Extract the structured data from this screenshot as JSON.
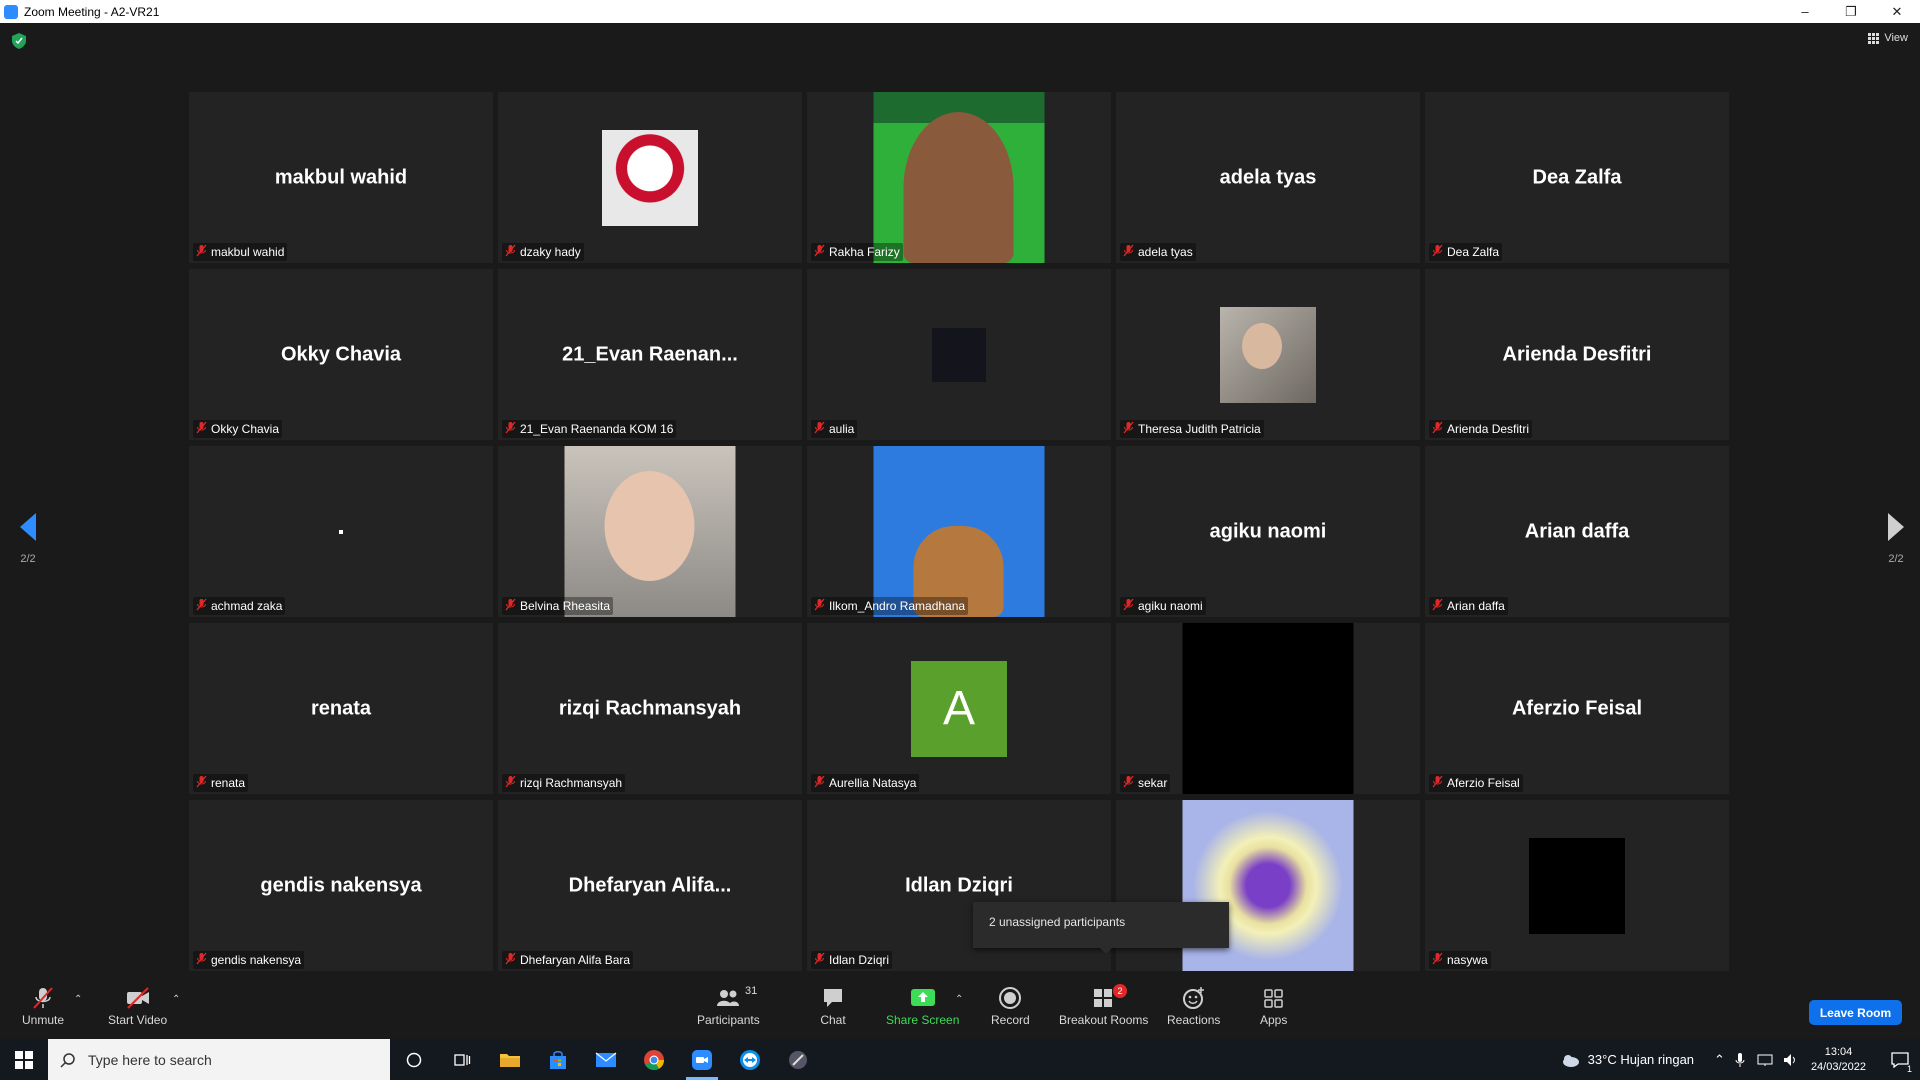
{
  "window": {
    "title": "Zoom Meeting - A2-VR21"
  },
  "header": {
    "view_label": "View"
  },
  "pagination": {
    "left": "2/2",
    "right": "2/2"
  },
  "tiles": [
    {
      "display": "makbul wahid",
      "label": "makbul wahid",
      "kind": "text"
    },
    {
      "display": "",
      "label": "dzaky hady",
      "kind": "picture-persija"
    },
    {
      "display": "",
      "label": "Rakha Farizy",
      "kind": "video-green"
    },
    {
      "display": "adela tyas",
      "label": "adela tyas",
      "kind": "text"
    },
    {
      "display": "Dea Zalfa",
      "label": "Dea Zalfa",
      "kind": "text"
    },
    {
      "display": "Okky Chavia",
      "label": "Okky Chavia",
      "kind": "text"
    },
    {
      "display": "21_Evan  Raenan...",
      "label": "21_Evan Raenanda KOM 16",
      "kind": "text"
    },
    {
      "display": "",
      "label": "aulia",
      "kind": "dark-square"
    },
    {
      "display": "",
      "label": "Theresa Judith Patricia",
      "kind": "picture-theresa"
    },
    {
      "display": "Arienda Desfitri",
      "label": "Arienda Desfitri",
      "kind": "text"
    },
    {
      "display": ".",
      "label": "achmad zaka",
      "kind": "dot"
    },
    {
      "display": "",
      "label": "Belvina Rheasita",
      "kind": "video-belvina"
    },
    {
      "display": "",
      "label": "Ilkom_Andro Ramadhana",
      "kind": "video-dog"
    },
    {
      "display": "agiku naomi",
      "label": "agiku naomi",
      "kind": "text"
    },
    {
      "display": "Arian daffa",
      "label": "Arian daffa",
      "kind": "text"
    },
    {
      "display": "renata",
      "label": "renata",
      "kind": "text"
    },
    {
      "display": "rizqi Rachmansyah",
      "label": "rizqi Rachmansyah",
      "kind": "text"
    },
    {
      "display": "A",
      "label": "Aurellia Natasya",
      "kind": "letter"
    },
    {
      "display": "",
      "label": "sekar",
      "kind": "video-black"
    },
    {
      "display": "Aferzio Feisal",
      "label": "Aferzio Feisal",
      "kind": "text"
    },
    {
      "display": "gendis nakensya",
      "label": "gendis nakensya",
      "kind": "text"
    },
    {
      "display": "Dhefaryan  Alifa...",
      "label": "Dhefaryan Alifa Bara",
      "kind": "text"
    },
    {
      "display": "Idlan Dziqri",
      "label": "Idlan Dziqri",
      "kind": "text"
    },
    {
      "display": "",
      "label": "",
      "kind": "video-heart"
    },
    {
      "display": "",
      "label": "nasywa",
      "kind": "black-square"
    }
  ],
  "popup": {
    "text": "2 unassigned participants"
  },
  "toolbar": {
    "unmute": "Unmute",
    "start_video": "Start Video",
    "participants": "Participants",
    "participants_count": "31",
    "chat": "Chat",
    "share_screen": "Share Screen",
    "record": "Record",
    "breakout_rooms": "Breakout Rooms",
    "breakout_badge": "2",
    "reactions": "Reactions",
    "apps": "Apps",
    "leave": "Leave Room"
  },
  "taskbar": {
    "search_placeholder": "Type here to search",
    "weather": "33°C  Hujan ringan",
    "time": "13:04",
    "date": "24/03/2022",
    "notifications": "1"
  },
  "colors": {
    "accent": "#2d8cff",
    "share_green": "#3ddc56",
    "leave_blue": "#0e71eb",
    "muted_red": "#e02828",
    "letter_avatar": "#5aa02c"
  }
}
